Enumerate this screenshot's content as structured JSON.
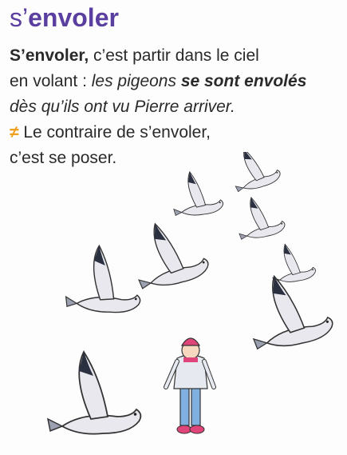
{
  "entry": {
    "headword_prefix": "s’",
    "headword_stem": "envoler"
  },
  "definition": {
    "term": "S’envoler,",
    "text1": " c’est partir dans le ciel",
    "text2": "en volant : ",
    "example_part1": "les pigeons ",
    "example_bold": "se sont envolés",
    "example_part2": "dès qu’ils ont vu Pierre arriver."
  },
  "antonym": {
    "symbol": "≠",
    "line1": " Le contraire de s’envoler,",
    "line2": "c’est se poser."
  },
  "illustration": {
    "subject": "pigeons flying away from a child in a pink hat",
    "colors": {
      "bird": "#e8e8ee",
      "wing_tip": "#2b3040",
      "hat": "#e0457a",
      "jacket": "#e6eaf0",
      "pants": "#7fb0e0"
    }
  }
}
